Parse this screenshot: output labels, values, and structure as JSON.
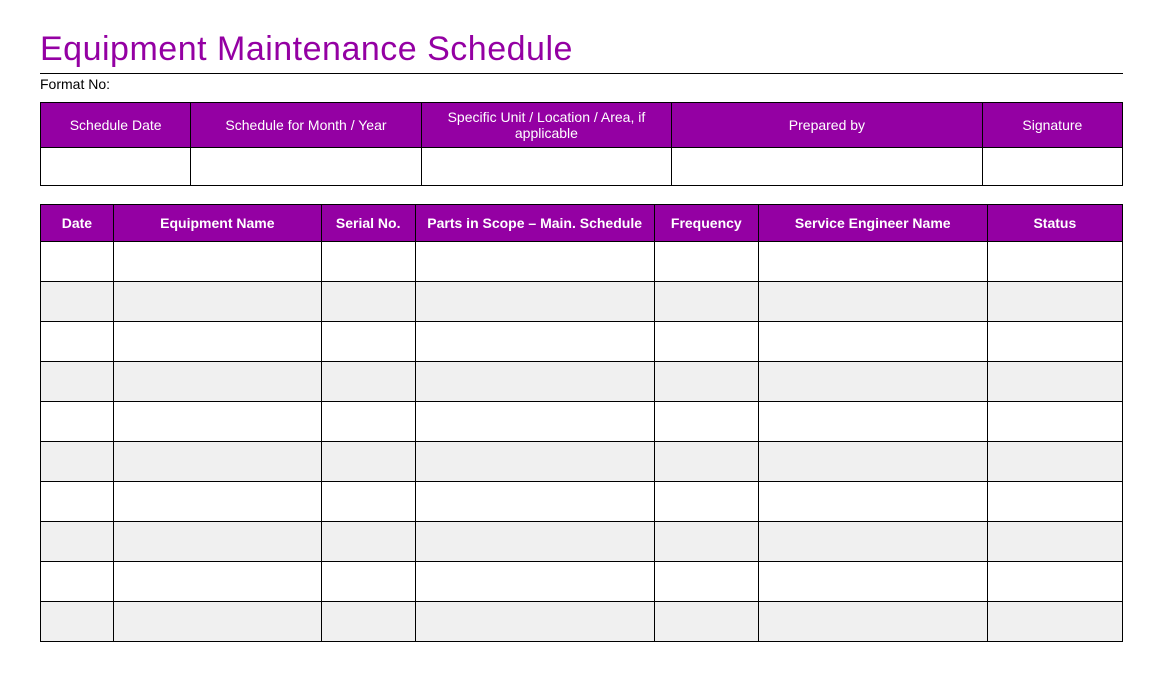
{
  "title": "Equipment Maintenance Schedule",
  "format_label": "Format No:",
  "meta_headers": {
    "schedule_date": "Schedule Date",
    "schedule_for": "Schedule for Month / Year",
    "unit": "Specific Unit / Location  / Area, if applicable",
    "prepared_by": "Prepared  by",
    "signature": "Signature"
  },
  "meta_values": {
    "schedule_date": "",
    "schedule_for": "",
    "unit": "",
    "prepared_by": "",
    "signature": ""
  },
  "main_headers": {
    "date": "Date",
    "equipment": "Equipment Name",
    "serial": "Serial No.",
    "parts": "Parts in Scope – Main. Schedule",
    "frequency": "Frequency",
    "engineer": "Service Engineer Name",
    "status": "Status"
  },
  "rows": [
    {
      "date": "",
      "equipment": "",
      "serial": "",
      "parts": "",
      "frequency": "",
      "engineer": "",
      "status": ""
    },
    {
      "date": "",
      "equipment": "",
      "serial": "",
      "parts": "",
      "frequency": "",
      "engineer": "",
      "status": ""
    },
    {
      "date": "",
      "equipment": "",
      "serial": "",
      "parts": "",
      "frequency": "",
      "engineer": "",
      "status": ""
    },
    {
      "date": "",
      "equipment": "",
      "serial": "",
      "parts": "",
      "frequency": "",
      "engineer": "",
      "status": ""
    },
    {
      "date": "",
      "equipment": "",
      "serial": "",
      "parts": "",
      "frequency": "",
      "engineer": "",
      "status": ""
    },
    {
      "date": "",
      "equipment": "",
      "serial": "",
      "parts": "",
      "frequency": "",
      "engineer": "",
      "status": ""
    },
    {
      "date": "",
      "equipment": "",
      "serial": "",
      "parts": "",
      "frequency": "",
      "engineer": "",
      "status": ""
    },
    {
      "date": "",
      "equipment": "",
      "serial": "",
      "parts": "",
      "frequency": "",
      "engineer": "",
      "status": ""
    },
    {
      "date": "",
      "equipment": "",
      "serial": "",
      "parts": "",
      "frequency": "",
      "engineer": "",
      "status": ""
    },
    {
      "date": "",
      "equipment": "",
      "serial": "",
      "parts": "",
      "frequency": "",
      "engineer": "",
      "status": ""
    }
  ]
}
